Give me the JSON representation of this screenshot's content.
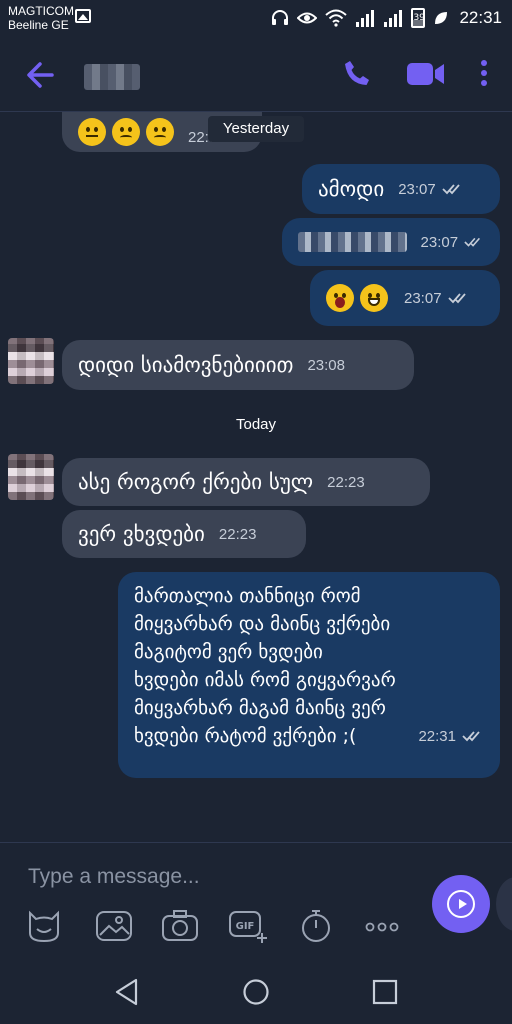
{
  "status_bar": {
    "carrier_line1": "MAGTICOM",
    "carrier_line2": "Beeline GE",
    "battery": "39",
    "time": "22:31",
    "icons": [
      "gallery-icon",
      "headset-icon",
      "eye-icon",
      "wifi-icon",
      "signal-icon",
      "battery-icon"
    ]
  },
  "header": {
    "icons": [
      "back-arrow-icon",
      "phone-icon",
      "video-call-icon",
      "more-vert-icon"
    ]
  },
  "chat": {
    "day_yesterday": "Yesterday",
    "day_today": "Today",
    "partial_time": "22:58",
    "messages": [
      {
        "dir": "out",
        "text": "ამოდი",
        "time": "23:07"
      },
      {
        "dir": "out",
        "text": "",
        "time": "23:07"
      },
      {
        "dir": "out",
        "text": "",
        "time": "23:07"
      },
      {
        "dir": "in",
        "text": "დიდი სიამოვნებიიით",
        "time": "23:08"
      },
      {
        "dir": "in",
        "text": "ასე როგორ ქრები სულ",
        "time": "22:23"
      },
      {
        "dir": "in",
        "text": "ვერ ვხვდები",
        "time": "22:23"
      },
      {
        "dir": "out",
        "lines": [
          "მართალია თანნიცი რომ",
          "მიყვარხარ და მაინც ვქრები",
          "მაგიტომ ვერ ხვდები",
          "ხვდები იმას რომ გიყვარვარ",
          "მიყვარხარ მაგამ მაინც ვერ",
          "ხვდები რატომ ვქრები ;("
        ],
        "time": "22:31"
      }
    ],
    "emoji": [
      "sad-emoji-icon",
      "shocked-emoji-icon",
      "grin-emoji-icon"
    ]
  },
  "composer": {
    "placeholder": "Type a message...",
    "tools": [
      "sticker-icon",
      "gallery-icon",
      "camera-icon",
      "gif-icon",
      "timer-icon",
      "more-icon"
    ],
    "send_icon": "send-icon"
  },
  "nav": [
    "back-nav-icon",
    "home-nav-icon",
    "recents-nav-icon"
  ],
  "colors": {
    "background": "#1c2433",
    "incoming": "#3b4354",
    "outgoing": "#1a3a63",
    "accent": "#7360f2"
  }
}
